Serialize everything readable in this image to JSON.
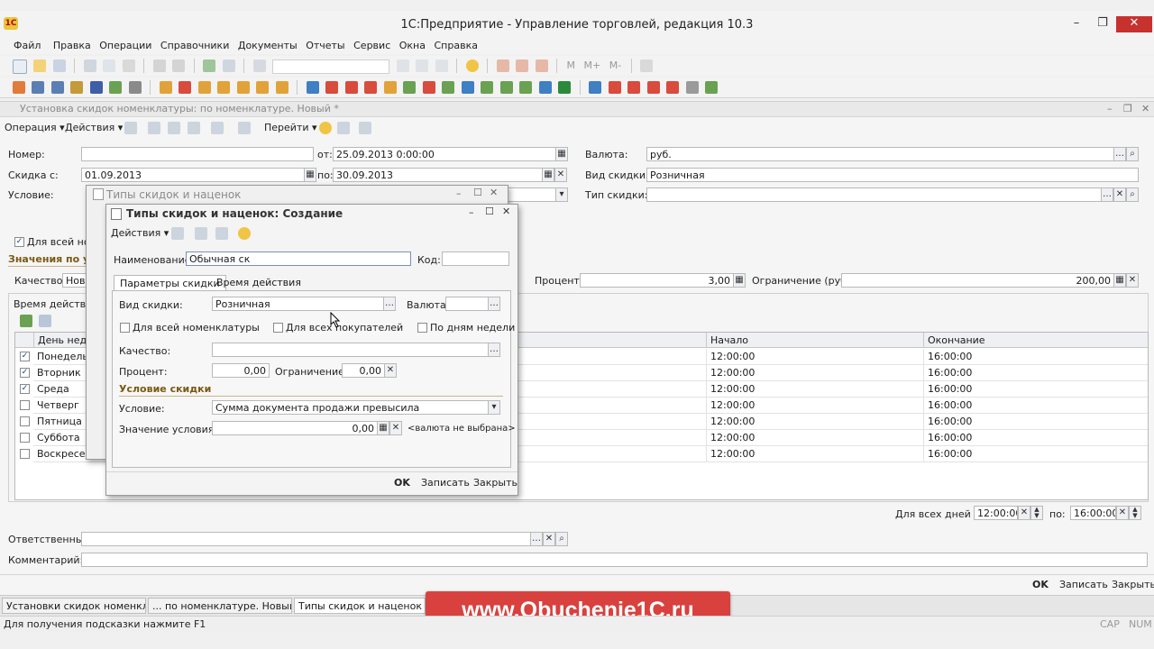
{
  "app": {
    "title": "1С:Предприятие - Управление торговлей, редакция 10.3",
    "menu": [
      "Файл",
      "Правка",
      "Операции",
      "Справочники",
      "Документы",
      "Отчеты",
      "Сервис",
      "Окна",
      "Справка"
    ]
  },
  "doc": {
    "window_title": "Установка скидок номенклатуры: по номенклатуре. Новый *",
    "cmd": {
      "operation": "Операция",
      "actions": "Действия",
      "goto": "Перейти"
    },
    "labels": {
      "number": "Номер:",
      "from": "от:",
      "discount_from": "Скидка с:",
      "to": "по:",
      "condition": "Условие:",
      "currency": "Валюта:",
      "discount_kind": "Вид скидки:",
      "discount_type": "Тип скидки:",
      "all_items": "Для всей ном",
      "values_section": "Значения по ум",
      "quality": "Качество:",
      "quality_value": "Нов",
      "percent": "Процент:",
      "limit": "Ограничение (руб.):",
      "time_section": "Время действия",
      "all_days": "Для всех дней с:",
      "days_to": "по:",
      "responsible": "Ответственный:",
      "comment": "Комментарий:"
    },
    "values": {
      "number": "",
      "date": "25.09.2013 0:00:00",
      "discount_from": "01.09.2013",
      "discount_to": "30.09.2013",
      "currency": "руб.",
      "discount_kind": "Розничная",
      "percent": "3,00",
      "limit": "200,00",
      "all_days_from": "12:00:00",
      "all_days_to": "16:00:00"
    },
    "days_table": {
      "headers": [
        "День неде",
        "Начало",
        "Окончание"
      ],
      "rows": [
        {
          "day": "Понедельн",
          "checked": true,
          "start": "12:00:00",
          "end": "16:00:00"
        },
        {
          "day": "Вторник",
          "checked": true,
          "start": "12:00:00",
          "end": "16:00:00"
        },
        {
          "day": "Среда",
          "checked": true,
          "start": "12:00:00",
          "end": "16:00:00"
        },
        {
          "day": "Четверг",
          "checked": false,
          "start": "12:00:00",
          "end": "16:00:00"
        },
        {
          "day": "Пятница",
          "checked": false,
          "start": "12:00:00",
          "end": "16:00:00"
        },
        {
          "day": "Суббота",
          "checked": false,
          "start": "12:00:00",
          "end": "16:00:00"
        },
        {
          "day": "Воскресен",
          "checked": false,
          "start": "12:00:00",
          "end": "16:00:00"
        }
      ]
    },
    "buttons": {
      "ok": "OK",
      "save": "Записать",
      "close": "Закрыть"
    }
  },
  "types_window": {
    "title": "Типы скидок и наценок"
  },
  "create_dialog": {
    "title": "Типы скидок и наценок: Создание",
    "actions": "Действия",
    "name_label": "Наименование:",
    "name_value": "Обычная ск",
    "code_label": "Код:",
    "code_value": "",
    "tabs": [
      "Параметры скидки",
      "Время действия"
    ],
    "labels": {
      "discount_kind": "Вид скидки:",
      "currency": "Валюта:",
      "all_items": "Для всей номенклатуры",
      "all_buyers": "Для всех покупателей",
      "by_weekdays": "По дням недели",
      "quality": "Качество:",
      "percent": "Процент:",
      "limit": "Ограничение:",
      "condition_section": "Условие скидки",
      "condition": "Условие:",
      "condition_value_label": "Значение условия:",
      "currency_hint": "<валюта не выбрана>"
    },
    "values": {
      "discount_kind": "Розничная",
      "currency": "",
      "quality": "",
      "percent": "0,00",
      "limit": "0,00",
      "condition": "Сумма документа продажи превысила",
      "condition_value": "0,00"
    },
    "buttons": {
      "ok": "OK",
      "save": "Записать",
      "close": "Закрыть"
    }
  },
  "taskbar": [
    "Установки скидок номенкл...",
    "... по номенклатуре. Новый *",
    "Типы скидок и наценок"
  ],
  "status": {
    "hint": "Для получения подсказки нажмите F1",
    "cap": "CAP",
    "num": "NUM"
  },
  "watermark": "www.Obuchenie1C.ru",
  "colors": {
    "accent": "#c7312e",
    "section": "#7a5a12",
    "watermark": "#d8413e"
  }
}
